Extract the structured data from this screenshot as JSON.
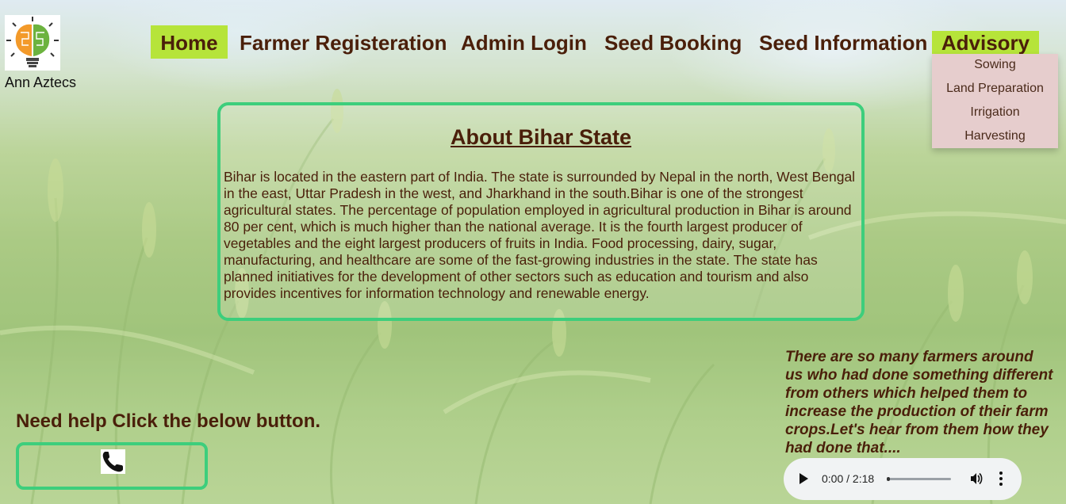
{
  "brand": {
    "name": "Ann Aztecs",
    "logo_icon": "brain-lightbulb-icon"
  },
  "nav": {
    "items": [
      {
        "label": "Home",
        "active": true
      },
      {
        "label": "Farmer Registeration"
      },
      {
        "label": "Admin Login"
      },
      {
        "label": "Seed Booking"
      },
      {
        "label": "Seed Information"
      },
      {
        "label": "Advisory",
        "active": true
      }
    ],
    "active_color": "#b6e43a",
    "text_color": "#4a1f0a"
  },
  "advisory_menu": {
    "items": [
      "Sowing",
      "Land Preparation",
      "Irrigation",
      "Harvesting"
    ],
    "background": "#e6cdcd"
  },
  "about": {
    "title": "About Bihar State",
    "body": "Bihar is located in the eastern part of India. The state is surrounded by Nepal in the north, West Bengal in the east, Uttar Pradesh in the west, and Jharkhand in the south.Bihar is one of the strongest agricultural states. The percentage of population employed in agricultural production in Bihar is around 80 per cent, which is much higher than the national average. It is the fourth largest producer of vegetables and the eight largest producers of fruits in India. Food processing, dairy, sugar, manufacturing, and healthcare are some of the fast-growing industries in the state. The state has planned initiatives for the development of other sectors such as education and tourism and also provides incentives for information technology and renewable energy.",
    "border_color": "#3dce7c"
  },
  "help": {
    "text": "Need help Click the below button.",
    "button_icon": "phone-icon"
  },
  "quote": {
    "text": "There are so many farmers around us who had done something different from others which helped them to increase the production of their farm crops.Let's hear from them how they had done that...."
  },
  "audio": {
    "time": "0:00 / 2:18",
    "progress": 0,
    "play_icon": "play-icon",
    "volume_icon": "volume-icon",
    "more_icon": "more-vertical-icon"
  }
}
